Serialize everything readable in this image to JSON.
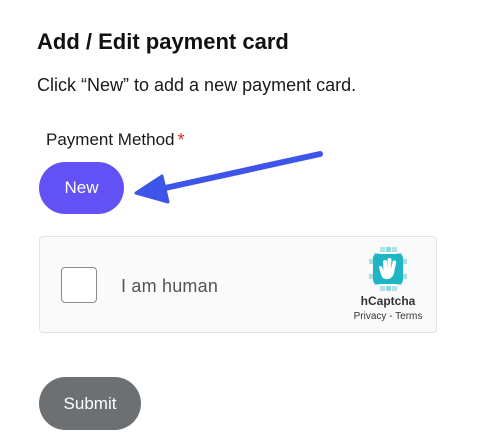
{
  "page": {
    "title": "Add / Edit payment card",
    "instructions": "Click “New” to add a new payment card."
  },
  "payment_method": {
    "label": "Payment Method",
    "required_marker": "*",
    "new_button_label": "New"
  },
  "annotation": {
    "arrow_color": "#3d55e8",
    "icon": "arrow-pointing-left-icon"
  },
  "captcha": {
    "checkbox_label": "I am human",
    "brand": "hCaptcha",
    "privacy_link": "Privacy",
    "separator": " - ",
    "terms_link": "Terms",
    "logo_icon": "hcaptcha-hand-icon",
    "checked": false
  },
  "form": {
    "submit_label": "Submit"
  },
  "colors": {
    "accent": "#6251f5",
    "required": "#d93025",
    "submit_bg": "#6c7073",
    "logo": "#1fb5c4"
  }
}
